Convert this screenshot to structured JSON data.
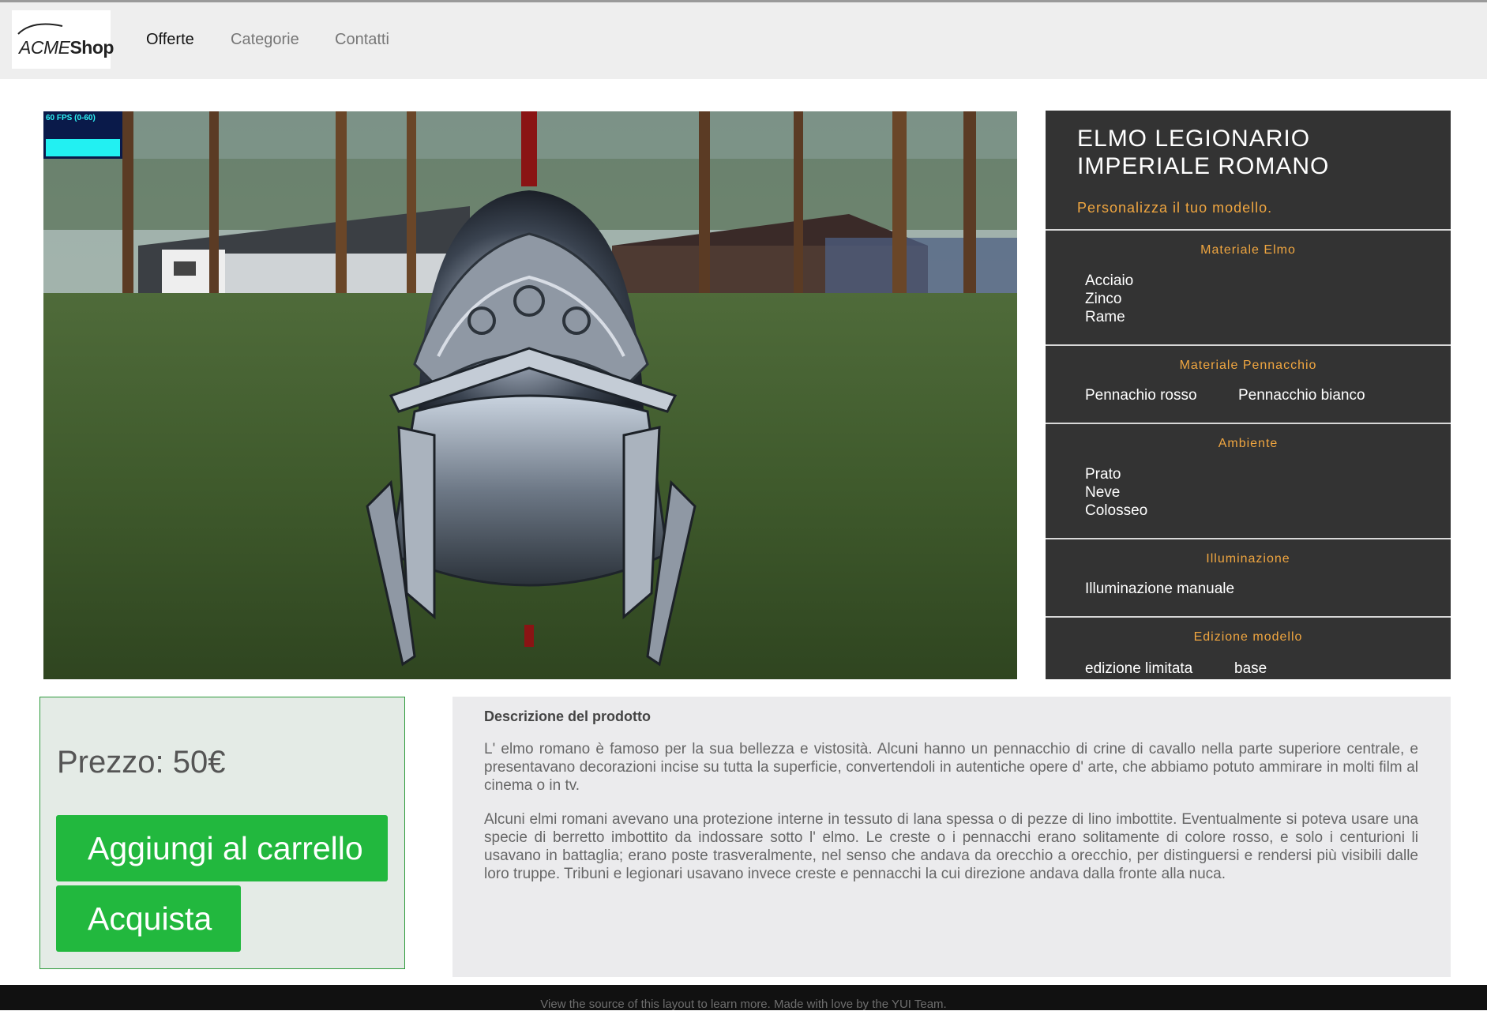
{
  "header": {
    "logo_text_acme": "ACME",
    "logo_text_shop": "Shop",
    "nav": [
      "Offerte",
      "Categorie",
      "Contatti"
    ]
  },
  "viewer": {
    "fps_label": "60 FPS (0-60)"
  },
  "product": {
    "title": "ELMO LEGIONARIO IMPERIALE ROMANO",
    "subtitle": "Personalizza il tuo modello.",
    "sections": [
      {
        "title": "Materiale Elmo",
        "options": [
          "Acciaio",
          "Zinco",
          "Rame"
        ]
      },
      {
        "title": "Materiale Pennacchio",
        "options": [
          "Pennachio rosso",
          "Pennacchio bianco"
        ]
      },
      {
        "title": "Ambiente",
        "options": [
          "Prato",
          "Neve",
          "Colosseo"
        ]
      },
      {
        "title": "Illuminazione",
        "options": [
          "Illuminazione manuale"
        ]
      },
      {
        "title": "Edizione modello",
        "options": [
          "edizione limitata",
          "base"
        ]
      }
    ]
  },
  "purchase": {
    "price": "Prezzo: 50€",
    "add_to_cart": "Aggiungi al carrello",
    "buy": "Acquista"
  },
  "description": {
    "title": "Descrizione del prodotto",
    "p1": "L' elmo romano è famoso per la sua bellezza e vistosità. Alcuni hanno un pennacchio di crine di cavallo nella parte superiore centrale, e presentavano decorazioni incise su tutta la superficie, convertendoli in autentiche opere d' arte, che abbiamo potuto ammirare in molti film al cinema o in tv.",
    "p2": "Alcuni elmi romani avevano una protezione interne in tessuto di lana spessa o di pezze di lino imbottite. Eventualmente si poteva usare una specie di berretto imbottito da indossare sotto l' elmo. Le creste o i pennacchi erano solitamente di colore rosso, e solo i centurioni li usavano in battaglia; erano poste trasveralmente, nel senso che andava da orecchio a orecchio, per distinguersi e rendersi più visibili dalle loro truppe. Tribuni e legionari usavano invece creste e pennacchi la cui direzione andava dalla fronte alla nuca."
  },
  "footer": {
    "text": "View the source of this layout to learn more. Made with love by the YUI Team."
  },
  "colors": {
    "accent": "#f0a640",
    "button": "#22b83e",
    "panel": "#333333"
  }
}
